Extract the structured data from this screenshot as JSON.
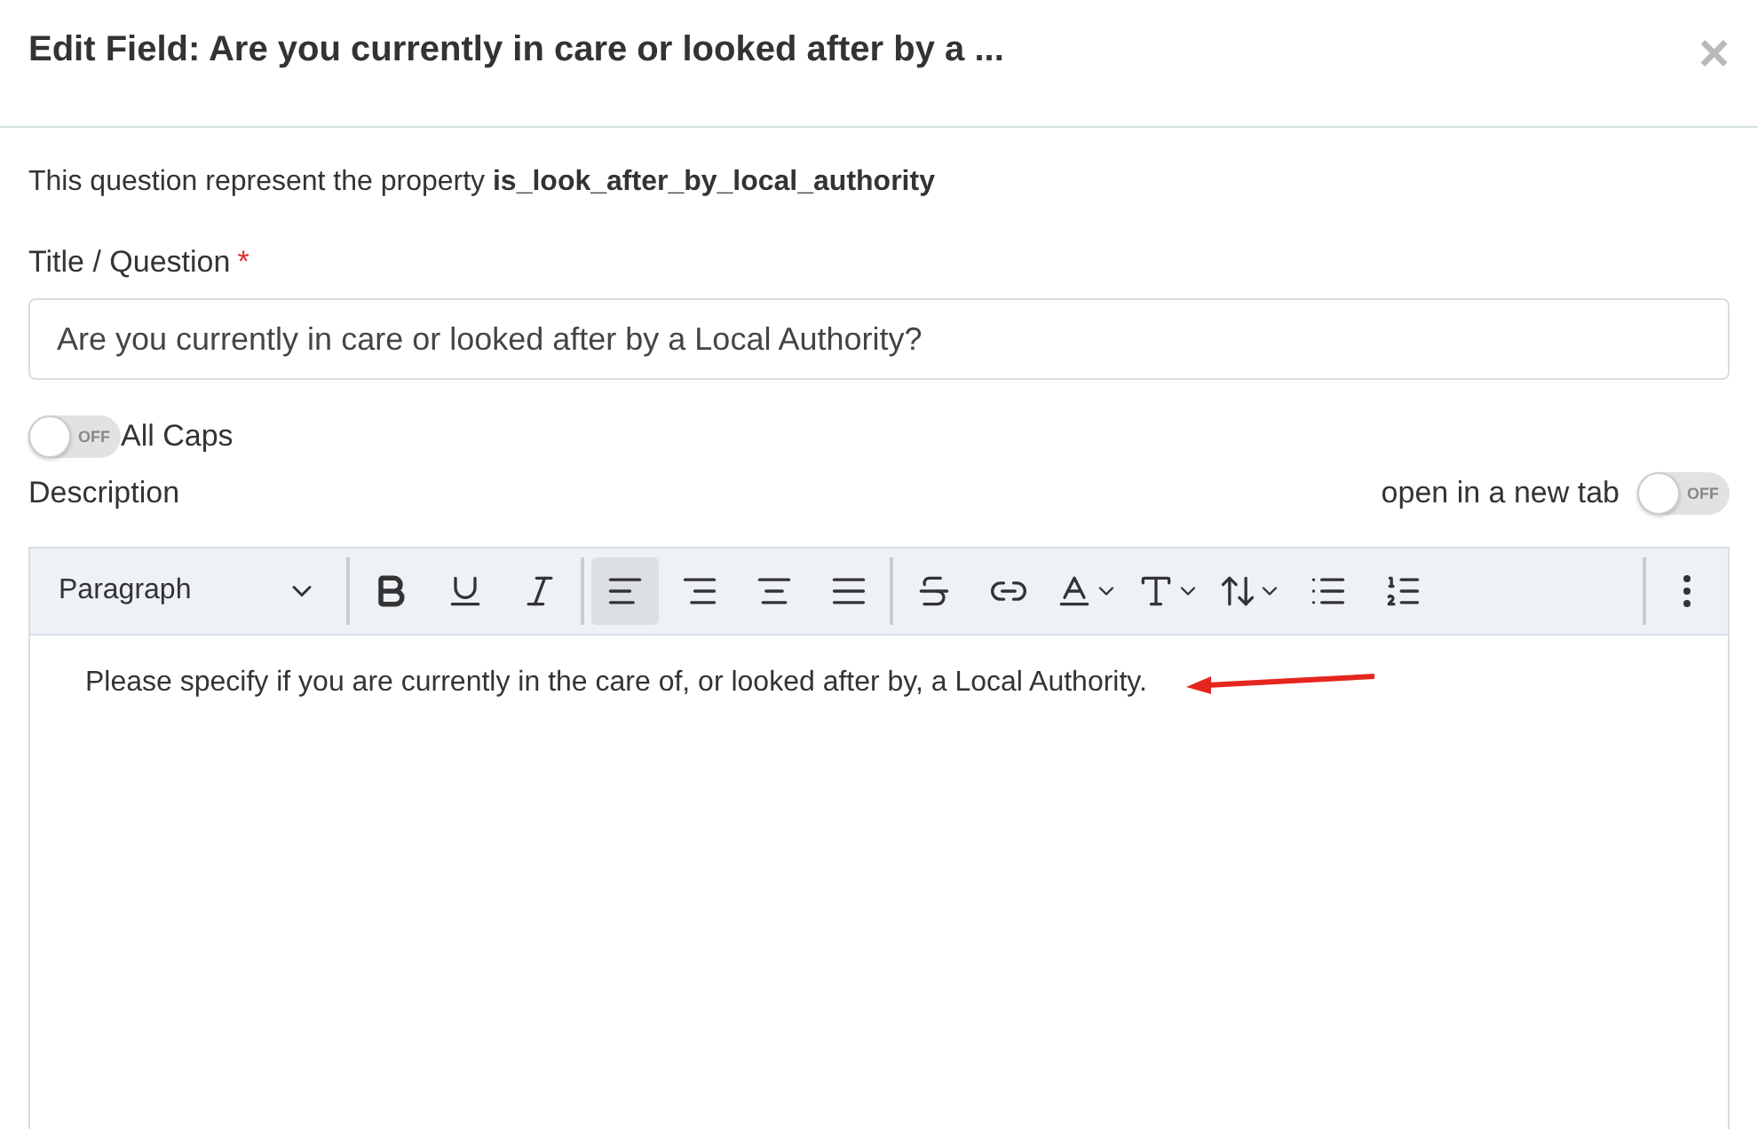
{
  "dialog": {
    "title": "Edit Field: Are you currently in care or looked after by a ...",
    "close": "×"
  },
  "property_note": "This question represent the property **is_look_after_by_local_authority**",
  "title_field": {
    "label": "Title / Question",
    "required": "*",
    "value": "Are you currently in care or looked after by a Local Authority?"
  },
  "all_caps": {
    "label": "All Caps",
    "on": false,
    "state_text": "OFF"
  },
  "description": {
    "label": "Description",
    "new_tab": {
      "label": "open in a new tab",
      "on": false,
      "state_text": "OFF"
    }
  },
  "toolbar": {
    "block_format": "Paragraph",
    "tools": [
      {
        "kind": "bold",
        "selected": false
      },
      {
        "kind": "underline",
        "selected": false
      },
      {
        "kind": "italic",
        "selected": false
      },
      {
        "kind": "divider"
      },
      {
        "kind": "align-left",
        "selected": true
      },
      {
        "kind": "align-right",
        "selected": false
      },
      {
        "kind": "align-center",
        "selected": false
      },
      {
        "kind": "align-justify",
        "selected": false
      },
      {
        "kind": "divider"
      },
      {
        "kind": "strikethrough",
        "selected": false
      },
      {
        "kind": "link",
        "selected": false
      },
      {
        "kind": "font-color",
        "selected": false
      },
      {
        "kind": "font-style",
        "selected": false
      },
      {
        "kind": "font-size",
        "selected": false
      },
      {
        "kind": "bullet-list",
        "selected": false
      },
      {
        "kind": "numbered-list",
        "selected": false
      }
    ]
  },
  "editor": {
    "text": "Please specify if you are currently in the care of, or looked after by, a Local Authority.",
    "annotation_arrow": true
  }
}
